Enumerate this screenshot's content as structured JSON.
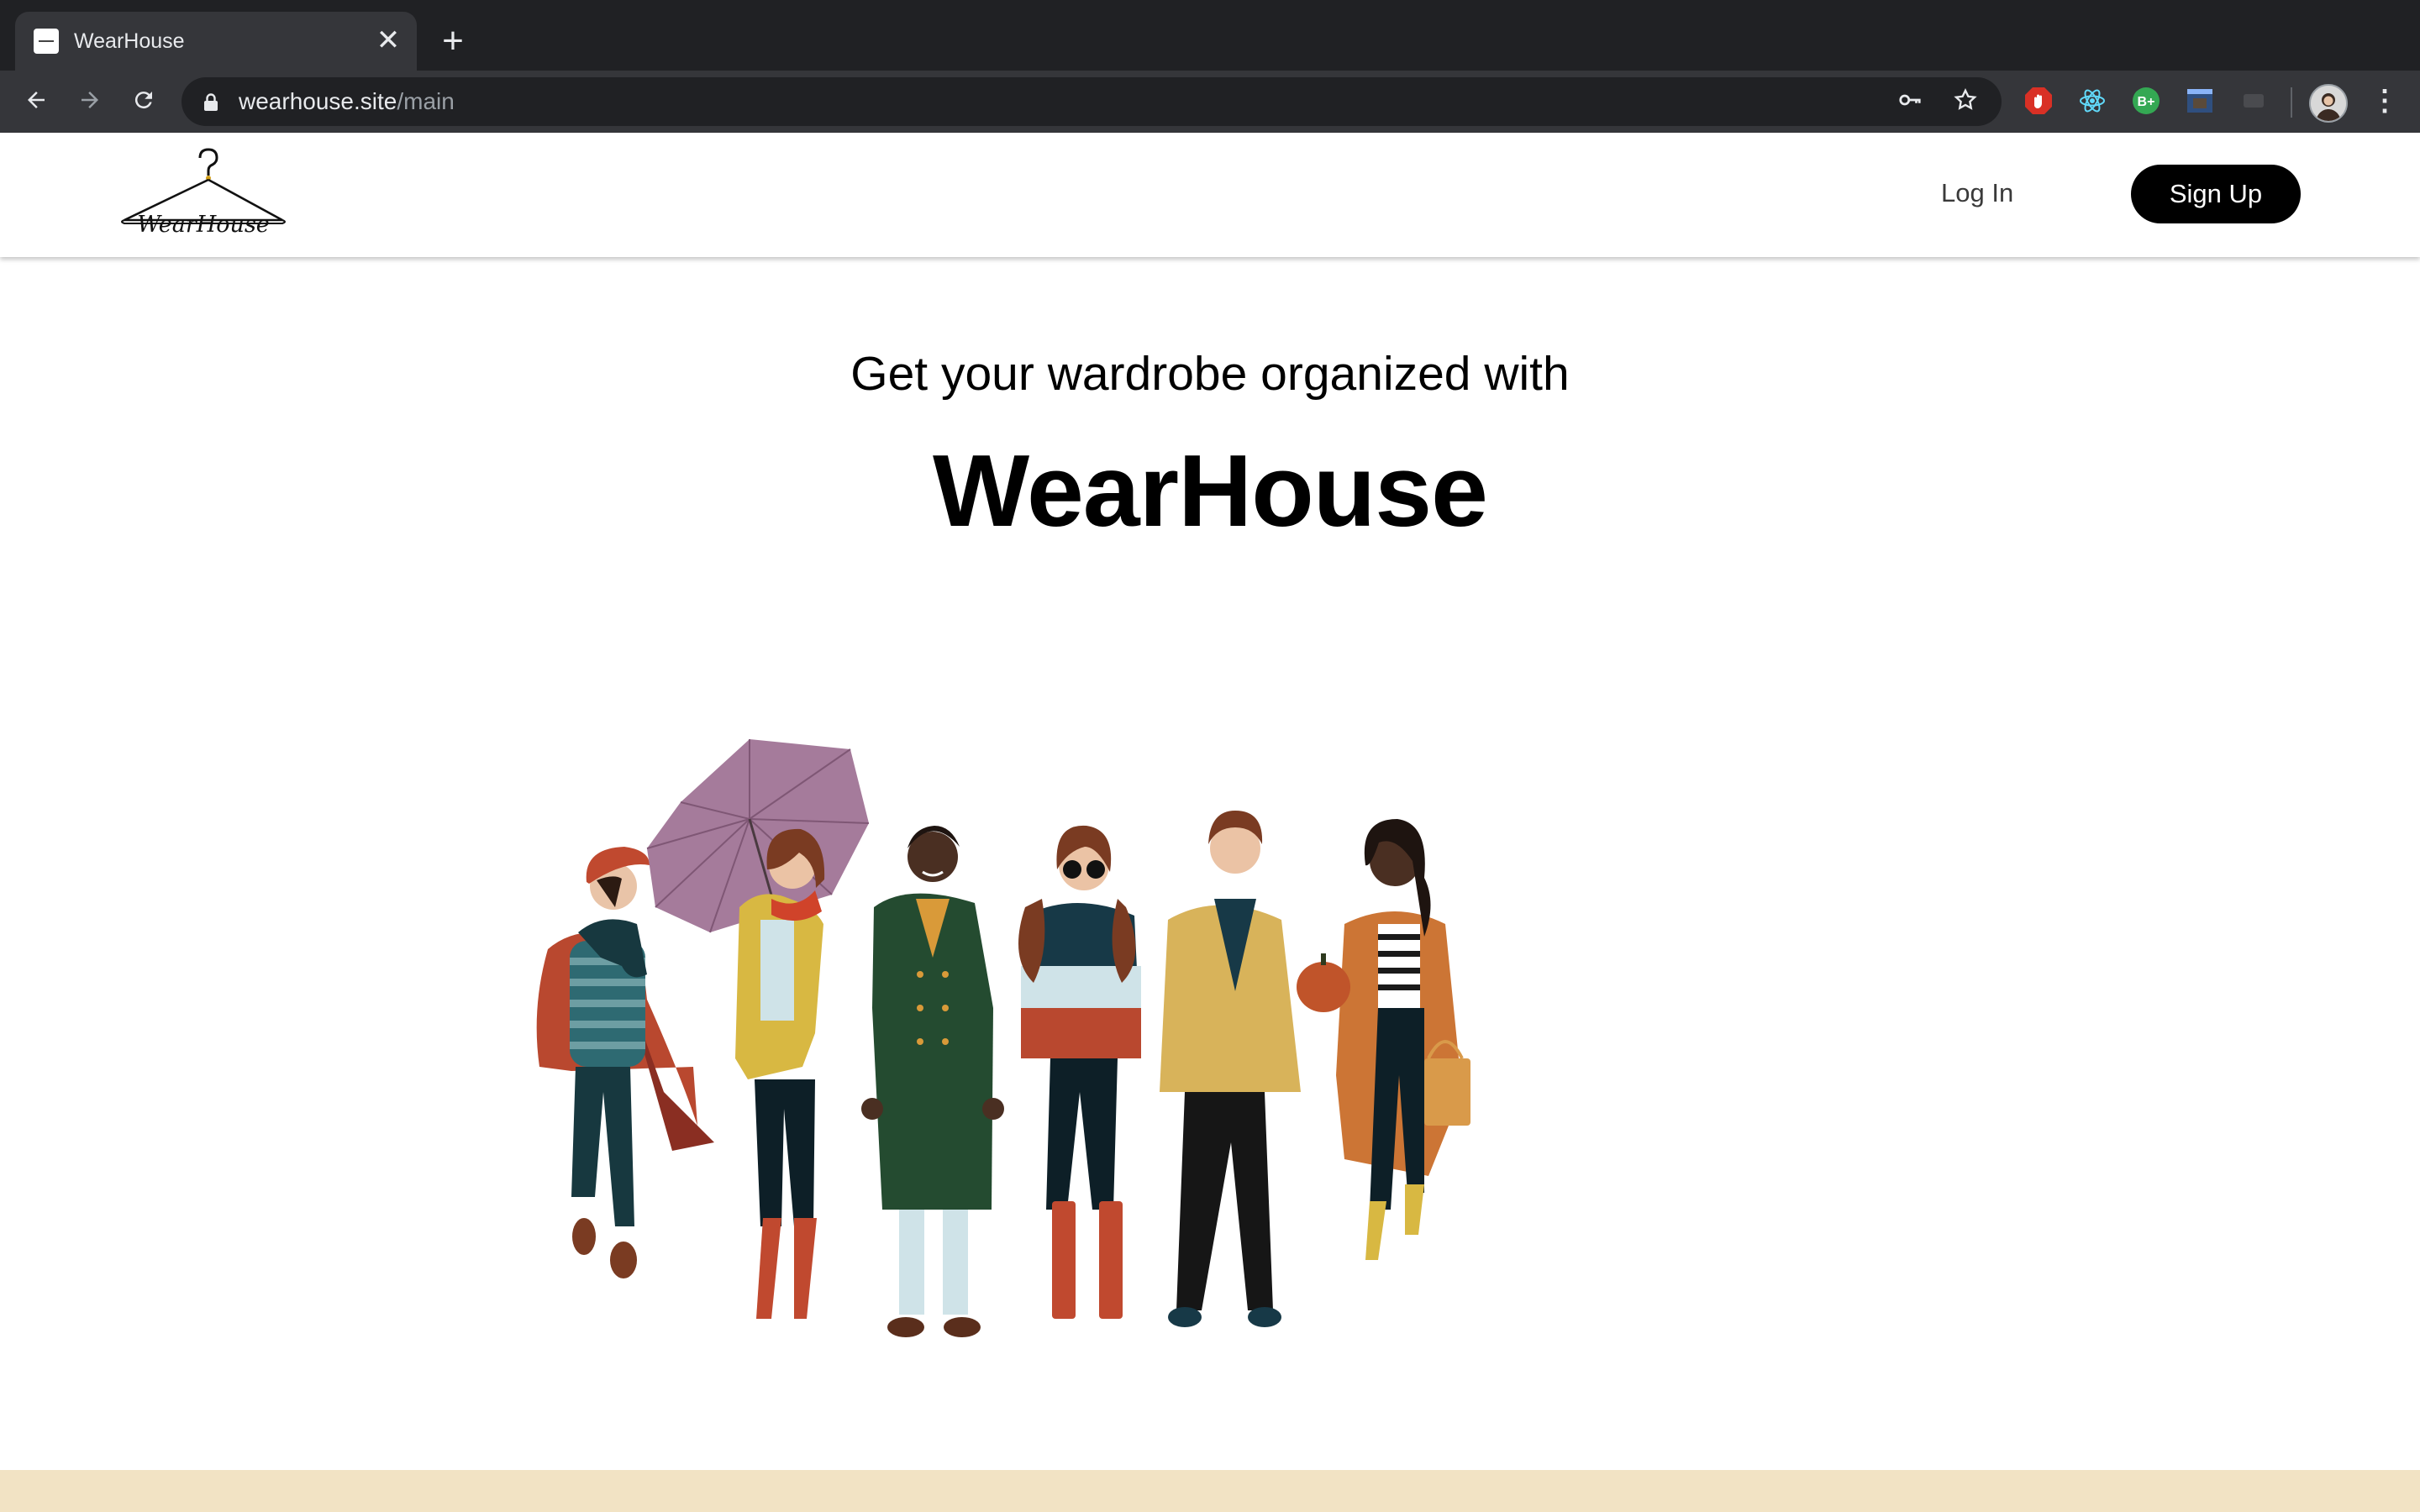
{
  "browser": {
    "tab_title": "WearHouse",
    "new_tab_label": "+",
    "close_label": "✕",
    "url_domain": "wearhouse.site",
    "url_path": "/main"
  },
  "header": {
    "logo_text": "WearHouse",
    "login_label": "Log In",
    "signup_label": "Sign Up"
  },
  "hero": {
    "subtitle": "Get your wardrobe organized with",
    "title": "WearHouse"
  },
  "illustration": {
    "icon": "people-illustration",
    "figures": [
      "red-coat-beret-person",
      "umbrella-yellow-jacket-person",
      "green-coat-person",
      "sunglasses-sweater-person",
      "yellow-jacket-person",
      "pumpkin-orange-coat-person"
    ]
  },
  "colors": {
    "accent": "#000000",
    "band": "#f2e3c4",
    "chrome_dark": "#202124",
    "chrome_toolbar": "#35363a"
  }
}
